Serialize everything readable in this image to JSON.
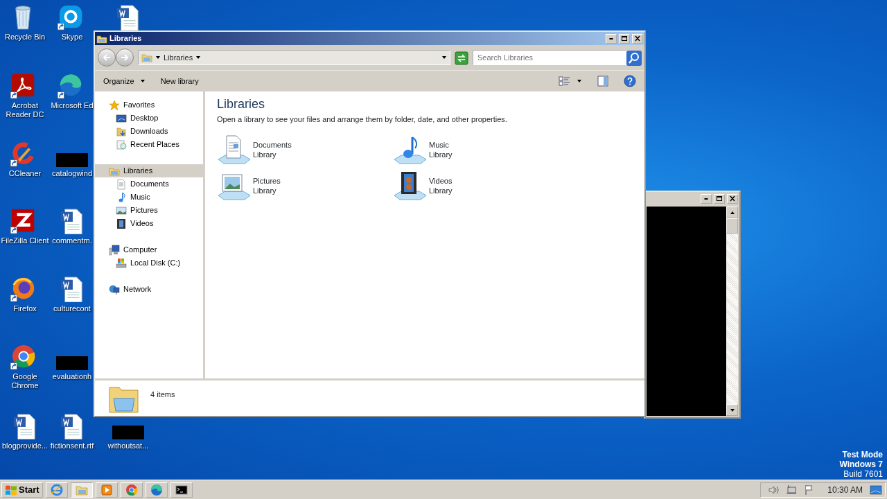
{
  "desktop_icons": [
    {
      "label": "Recycle Bin",
      "kind": "recycle",
      "shortcut": false
    },
    {
      "label": "Acrobat Reader DC",
      "kind": "acrobat",
      "shortcut": true
    },
    {
      "label": "CCleaner",
      "kind": "ccleaner",
      "shortcut": true
    },
    {
      "label": "FileZilla Client",
      "kind": "filezilla",
      "shortcut": true
    },
    {
      "label": "Firefox",
      "kind": "firefox",
      "shortcut": true
    },
    {
      "label": "Google Chrome",
      "kind": "chrome",
      "shortcut": true
    },
    {
      "label": "blogprovide...",
      "kind": "word",
      "shortcut": false
    },
    {
      "label": "Skype",
      "kind": "skype",
      "shortcut": true
    },
    {
      "label": "Microsoft Ed",
      "kind": "edge",
      "shortcut": true
    },
    {
      "label": "catalogwind",
      "kind": "redacted",
      "shortcut": false
    },
    {
      "label": "commentm.",
      "kind": "word",
      "shortcut": false
    },
    {
      "label": "culturecont",
      "kind": "word",
      "shortcut": false
    },
    {
      "label": "evaluationh",
      "kind": "redacted",
      "shortcut": false
    },
    {
      "label": "fictionsent.rtf",
      "kind": "word",
      "shortcut": false
    },
    {
      "kind": "word",
      "shortcut": false
    },
    {
      "label": "withoutsat...",
      "kind": "redacted",
      "shortcut": false
    }
  ],
  "explorer": {
    "title": "Libraries",
    "address": "Libraries",
    "search": {
      "placeholder": "Search Libraries"
    },
    "toolbar": [
      {
        "label": "Organize",
        "dropdown": true
      },
      {
        "label": "New library",
        "dropdown": false
      }
    ],
    "nav": [
      {
        "label": "Favorites",
        "kind": "star",
        "selected": false,
        "children": [
          {
            "label": "Desktop",
            "kind": "desktop",
            "selected": false
          },
          {
            "label": "Downloads",
            "kind": "downloads",
            "selected": false
          },
          {
            "label": "Recent Places",
            "kind": "recent",
            "selected": false
          }
        ]
      },
      {
        "label": "Libraries",
        "kind": "library",
        "selected": true,
        "children": [
          {
            "label": "Documents",
            "kind": "documents",
            "selected": false
          },
          {
            "label": "Music",
            "kind": "music",
            "selected": false
          },
          {
            "label": "Pictures",
            "kind": "pictures",
            "selected": false
          },
          {
            "label": "Videos",
            "kind": "videos",
            "selected": false
          }
        ]
      },
      {
        "label": "Computer",
        "kind": "computer",
        "selected": false,
        "children": [
          {
            "label": "Local Disk (C:)",
            "kind": "disk",
            "selected": false
          }
        ]
      },
      {
        "label": "Network",
        "kind": "network",
        "selected": false
      }
    ],
    "heading": "Libraries",
    "description": "Open a library to see your files and arrange them by folder, date, and other properties.",
    "libraries": [
      {
        "name": "Documents",
        "subtitle": "Library",
        "kind": "documents"
      },
      {
        "name": "Music",
        "subtitle": "Library",
        "kind": "music"
      },
      {
        "name": "Pictures",
        "subtitle": "Library",
        "kind": "pictures"
      },
      {
        "name": "Videos",
        "subtitle": "Library",
        "kind": "videos"
      }
    ],
    "status": "4 items"
  },
  "taskbar": {
    "start": "Start",
    "buttons": [
      {
        "kind": "ie",
        "selected": false
      },
      {
        "kind": "explorer",
        "selected": true
      },
      {
        "kind": "media",
        "selected": false
      },
      {
        "kind": "chrome",
        "selected": false
      },
      {
        "kind": "edge",
        "selected": false
      },
      {
        "kind": "cmd",
        "selected": false
      }
    ],
    "clock": "10:30 AM"
  },
  "os_notice": [
    {
      "text": "Test Mode",
      "bold": true
    },
    {
      "text": "Windows 7",
      "bold": true
    },
    {
      "text": "Build 7601",
      "bold": false
    }
  ]
}
